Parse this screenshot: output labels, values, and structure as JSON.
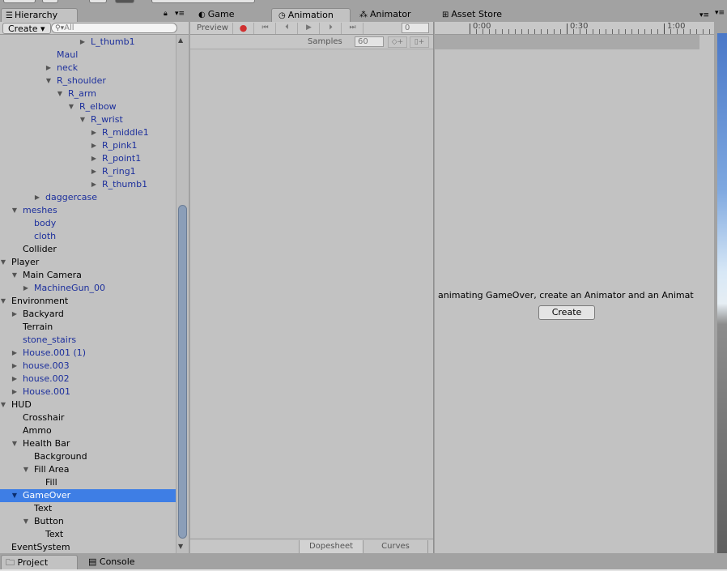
{
  "hierarchy": {
    "tab_label": "Hierarchy",
    "create_label": "Create",
    "search_placeholder": "All",
    "items": [
      {
        "label": "L_thumb1",
        "depth": 8,
        "arrow": "right",
        "blue": true
      },
      {
        "label": "Maul",
        "depth": 5,
        "arrow": "",
        "blue": true
      },
      {
        "label": "neck",
        "depth": 5,
        "arrow": "right",
        "blue": true
      },
      {
        "label": "R_shoulder",
        "depth": 5,
        "arrow": "down",
        "blue": true
      },
      {
        "label": "R_arm",
        "depth": 6,
        "arrow": "down",
        "blue": true
      },
      {
        "label": "R_elbow",
        "depth": 7,
        "arrow": "down",
        "blue": true
      },
      {
        "label": "R_wrist",
        "depth": 8,
        "arrow": "down",
        "blue": true
      },
      {
        "label": "R_middle1",
        "depth": 9,
        "arrow": "right",
        "blue": true
      },
      {
        "label": "R_pink1",
        "depth": 9,
        "arrow": "right",
        "blue": true
      },
      {
        "label": "R_point1",
        "depth": 9,
        "arrow": "right",
        "blue": true
      },
      {
        "label": "R_ring1",
        "depth": 9,
        "arrow": "right",
        "blue": true
      },
      {
        "label": "R_thumb1",
        "depth": 9,
        "arrow": "right",
        "blue": true
      },
      {
        "label": "daggercase",
        "depth": 4,
        "arrow": "right",
        "blue": true
      },
      {
        "label": "meshes",
        "depth": 2,
        "arrow": "down",
        "blue": true
      },
      {
        "label": "body",
        "depth": 3,
        "arrow": "",
        "blue": true
      },
      {
        "label": "cloth",
        "depth": 3,
        "arrow": "",
        "blue": true
      },
      {
        "label": "Collider",
        "depth": 2,
        "arrow": "",
        "blue": false
      },
      {
        "label": "Player",
        "depth": 1,
        "arrow": "down",
        "blue": false
      },
      {
        "label": "Main Camera",
        "depth": 2,
        "arrow": "down",
        "blue": false
      },
      {
        "label": "MachineGun_00",
        "depth": 3,
        "arrow": "right",
        "blue": true
      },
      {
        "label": "Environment",
        "depth": 1,
        "arrow": "down",
        "blue": false
      },
      {
        "label": "Backyard",
        "depth": 2,
        "arrow": "right",
        "blue": false
      },
      {
        "label": "Terrain",
        "depth": 2,
        "arrow": "",
        "blue": false
      },
      {
        "label": "stone_stairs",
        "depth": 2,
        "arrow": "",
        "blue": true
      },
      {
        "label": "House.001 (1)",
        "depth": 2,
        "arrow": "right",
        "blue": true
      },
      {
        "label": "house.003",
        "depth": 2,
        "arrow": "right",
        "blue": true
      },
      {
        "label": "house.002",
        "depth": 2,
        "arrow": "right",
        "blue": true
      },
      {
        "label": "House.001",
        "depth": 2,
        "arrow": "right",
        "blue": true
      },
      {
        "label": "HUD",
        "depth": 1,
        "arrow": "down",
        "blue": false
      },
      {
        "label": "Crosshair",
        "depth": 2,
        "arrow": "",
        "blue": false
      },
      {
        "label": "Ammo",
        "depth": 2,
        "arrow": "",
        "blue": false
      },
      {
        "label": "Health Bar",
        "depth": 2,
        "arrow": "down",
        "blue": false
      },
      {
        "label": "Background",
        "depth": 3,
        "arrow": "",
        "blue": false
      },
      {
        "label": "Fill Area",
        "depth": 3,
        "arrow": "down",
        "blue": false
      },
      {
        "label": "Fill",
        "depth": 4,
        "arrow": "",
        "blue": false
      },
      {
        "label": "GameOver",
        "depth": 2,
        "arrow": "down",
        "blue": false,
        "selected": true
      },
      {
        "label": "Text",
        "depth": 3,
        "arrow": "",
        "blue": false
      },
      {
        "label": "Button",
        "depth": 3,
        "arrow": "down",
        "blue": false
      },
      {
        "label": "Text",
        "depth": 4,
        "arrow": "",
        "blue": false
      },
      {
        "label": "EventSystem",
        "depth": 1,
        "arrow": "",
        "blue": false
      }
    ]
  },
  "tabs": {
    "game": "Game",
    "animation": "Animation",
    "animator": "Animator",
    "asset_store": "Asset Store"
  },
  "animation": {
    "preview_label": "Preview",
    "frame_value": "0",
    "samples_label": "Samples",
    "samples_value": "60",
    "ruler_labels": [
      "0:00",
      "0:30",
      "1:00"
    ],
    "message": "animating GameOver, create an Animator and an Animat",
    "create_label": "Create",
    "dopesheet_label": "Dopesheet",
    "curves_label": "Curves"
  },
  "bottom": {
    "project_label": "Project",
    "console_label": "Console"
  },
  "colors": {
    "selection": "#3e7ee5",
    "prefab_blue": "#1c2f9c",
    "record_red": "#d02f2f",
    "panel_bg": "#c2c2c2"
  }
}
